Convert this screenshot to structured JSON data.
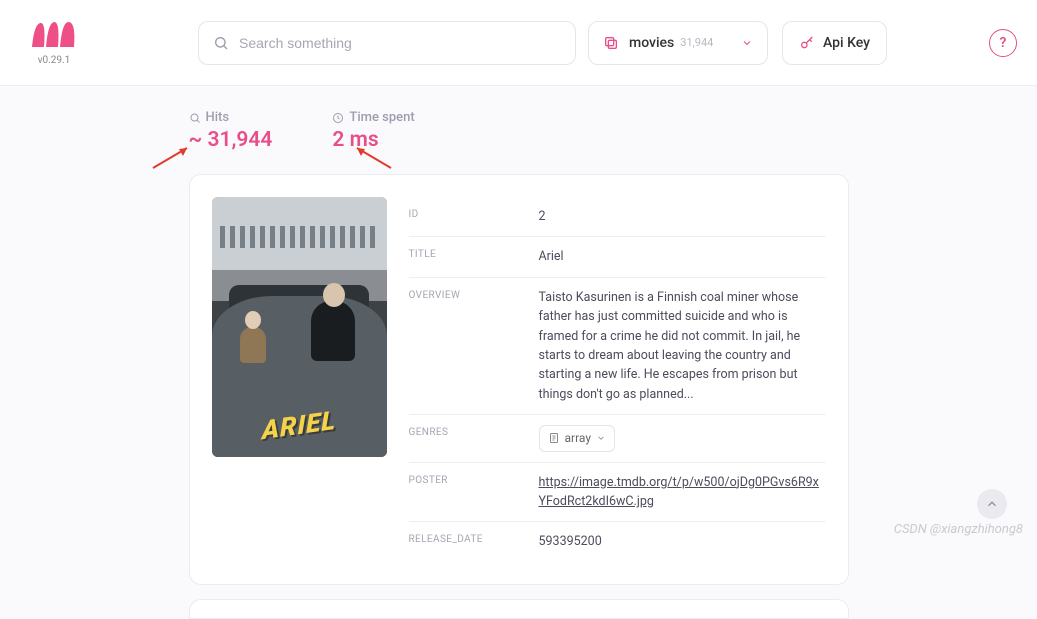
{
  "app": {
    "version": "v0.29.1"
  },
  "search": {
    "placeholder": "Search something"
  },
  "index_selector": {
    "name": "movies",
    "count": "31,944"
  },
  "api_key_button": "Api Key",
  "help_button": "?",
  "stats": {
    "hits": {
      "label": "Hits",
      "value": "~ 31,944"
    },
    "time": {
      "label": "Time spent",
      "value": "2 ms"
    }
  },
  "result": {
    "poster_title": "ARIEL",
    "fields": {
      "id": {
        "key": "ID",
        "value": "2"
      },
      "title": {
        "key": "TITLE",
        "value": "Ariel"
      },
      "overview": {
        "key": "OVERVIEW",
        "value": "Taisto Kasurinen is a Finnish coal miner whose father has just committed suicide and who is framed for a crime he did not commit. In jail, he starts to dream about leaving the country and starting a new life. He escapes from prison but things don't go as planned..."
      },
      "genres": {
        "key": "GENRES",
        "pill": "array"
      },
      "poster": {
        "key": "POSTER",
        "value": "https://image.tmdb.org/t/p/w500/ojDg0PGvs6R9xYFodRct2kdI6wC.jpg"
      },
      "release_date": {
        "key": "RELEASE_DATE",
        "value": "593395200"
      }
    }
  },
  "watermark": "CSDN @xiangzhihong8"
}
